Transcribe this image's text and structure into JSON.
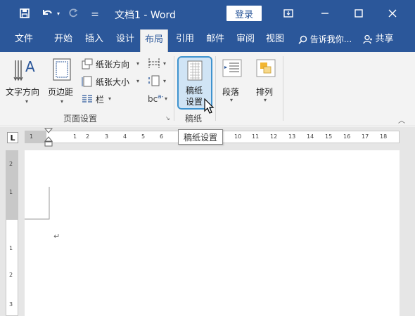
{
  "window": {
    "title": "文档1 - Word",
    "login_label": "登录"
  },
  "tabs": [
    {
      "label": "文件"
    },
    {
      "label": "开始"
    },
    {
      "label": "插入"
    },
    {
      "label": "设计"
    },
    {
      "label": "布局"
    },
    {
      "label": "引用"
    },
    {
      "label": "邮件"
    },
    {
      "label": "审阅"
    },
    {
      "label": "视图"
    }
  ],
  "tell_me": "告诉我你...",
  "share": "共享",
  "ribbon": {
    "text_direction": "文字方向",
    "margins": "页边距",
    "orientation": "纸张方向",
    "size": "纸张大小",
    "columns": "栏",
    "page_setup_group": "页面设置",
    "gaozhi_line1": "稿纸",
    "gaozhi_line2": "设置",
    "gaozhi_group": "稿纸",
    "paragraph": "段落",
    "arrange": "排列"
  },
  "tooltip": "稿纸设置",
  "ruler": {
    "tab_marker": "L",
    "h_ticks": [
      "1",
      "1",
      "2",
      "3",
      "4",
      "5",
      "6",
      "10",
      "11",
      "12",
      "13",
      "14",
      "15",
      "16",
      "17",
      "18"
    ],
    "v_ticks": [
      "2",
      "1",
      "1",
      "2",
      "3"
    ]
  },
  "document": {
    "return_mark": "↵"
  }
}
